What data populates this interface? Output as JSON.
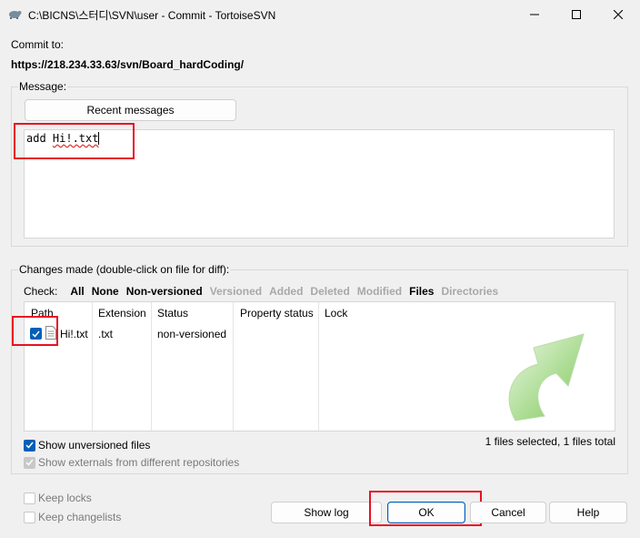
{
  "window": {
    "title": "C:\\BICNS\\스터디\\SVN\\user - Commit - TortoiseSVN",
    "minimize_glyph": "—",
    "maximize_glyph": "☐",
    "close_glyph": "✕"
  },
  "commit_to": {
    "label": "Commit to:",
    "url": "https://218.234.33.63/svn/Board_hardCoding/"
  },
  "message": {
    "group_label": "Message:",
    "recent_button": "Recent messages",
    "text_prefix": "add ",
    "text_word": "Hi!.txt"
  },
  "changes": {
    "group_label": "Changes made (double-click on file for diff):",
    "check_label": "Check:",
    "filters": [
      {
        "label": "All",
        "enabled": true
      },
      {
        "label": "None",
        "enabled": true
      },
      {
        "label": "Non-versioned",
        "enabled": true
      },
      {
        "label": "Versioned",
        "enabled": false
      },
      {
        "label": "Added",
        "enabled": false
      },
      {
        "label": "Deleted",
        "enabled": false
      },
      {
        "label": "Modified",
        "enabled": false
      },
      {
        "label": "Files",
        "enabled": true
      },
      {
        "label": "Directories",
        "enabled": false
      }
    ],
    "columns": [
      "Path",
      "Extension",
      "Status",
      "Property status",
      "Lock"
    ],
    "rows": [
      {
        "checked": true,
        "path": "Hi!.txt",
        "extension": ".txt",
        "status": "non-versioned",
        "property_status": "",
        "lock": ""
      }
    ],
    "summary": "1 files selected, 1 files total",
    "show_unversioned": {
      "label": "Show unversioned files",
      "checked": true
    },
    "show_externals": {
      "label": "Show externals from different repositories",
      "checked": true,
      "disabled": true
    }
  },
  "options": {
    "keep_locks": {
      "label": "Keep locks",
      "checked": false
    },
    "keep_changelists": {
      "label": "Keep changelists",
      "checked": false
    }
  },
  "buttons": {
    "show_log": "Show log",
    "ok": "OK",
    "cancel": "Cancel",
    "help": "Help"
  },
  "colors": {
    "accent": "#005fb8",
    "highlight_box": "#e81123",
    "watermark_arrow": "#6fc24a"
  }
}
